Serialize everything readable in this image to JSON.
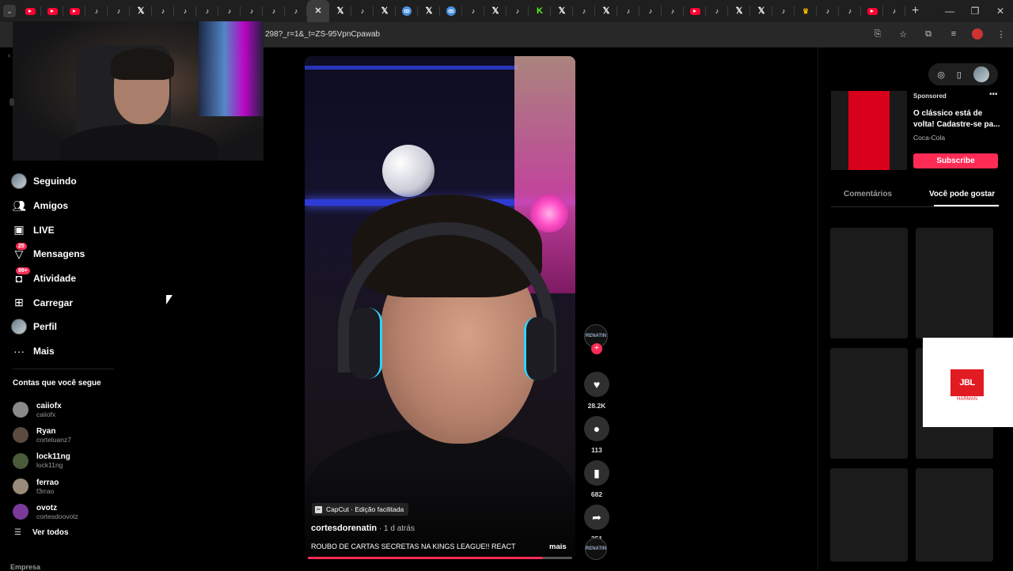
{
  "browser": {
    "tabs": [
      "yt",
      "yt",
      "yt",
      "tt",
      "tt",
      "x",
      "tt",
      "tt",
      "tt",
      "tt",
      "tt",
      "tt",
      "tt",
      "close",
      "x",
      "tt",
      "x",
      "meet",
      "x",
      "meet",
      "tt",
      "x",
      "tt",
      "kick",
      "x",
      "tt",
      "x",
      "tt",
      "tt",
      "tt",
      "yt",
      "tt",
      "x",
      "x",
      "tt",
      "crown",
      "tt",
      "tt",
      "yt",
      "tt"
    ],
    "tab_close_glyph": "✕",
    "new_tab_glyph": "+",
    "url": "298?_r=1&_t=ZS-95VpnCpawab"
  },
  "sidebar": {
    "items": [
      {
        "label": "Seguindo",
        "icon": "following-avatar-icon",
        "badge": ""
      },
      {
        "label": "Amigos",
        "icon": "friends-icon",
        "badge": ""
      },
      {
        "label": "LIVE",
        "icon": "live-tv-icon",
        "badge": ""
      },
      {
        "label": "Mensagens",
        "icon": "messages-icon",
        "badge": "25"
      },
      {
        "label": "Atividade",
        "icon": "activity-icon",
        "badge": "99+"
      },
      {
        "label": "Carregar",
        "icon": "upload-icon",
        "badge": ""
      },
      {
        "label": "Perfil",
        "icon": "profile-avatar-icon",
        "badge": ""
      },
      {
        "label": "Mais",
        "icon": "more-dots-icon",
        "badge": ""
      }
    ],
    "following_header": "Contas que você segue",
    "accounts": [
      {
        "name": "caiiofx",
        "handle": "caiiofx",
        "color": "#8a8a8a"
      },
      {
        "name": "Ryan",
        "handle": "corteluanz7",
        "color": "#5a4a40"
      },
      {
        "name": "lock11ng",
        "handle": "lock11ng",
        "color": "#4a5a3a"
      },
      {
        "name": "ferrao",
        "handle": "f3rrao",
        "color": "#9a8a7a"
      },
      {
        "name": "ovotz",
        "handle": "cortesdoovotz",
        "color": "#7a3a9a"
      }
    ],
    "see_all": "Ver todos",
    "footer_label": "Empresa"
  },
  "video": {
    "capcut_label": "CapCut · Edição facilitada",
    "author": "cortesdorenatin",
    "time": " · 1 d atrás",
    "caption": "ROUBO DE CARTAS SECRETAS NA KINGS LEAGUE!! REACT",
    "more": "mais",
    "progress_fraction": 0.89
  },
  "actions": {
    "avatar_text": "RENATIN",
    "likes": "28.2K",
    "comments": "113",
    "saves": "682",
    "shares": "251"
  },
  "right_panel": {
    "ad": {
      "sponsored": "Sponsored",
      "title": "O clássico está de volta! Cadastre-se pa...",
      "brand": "Coca-Cola",
      "cta": "Subscribe"
    },
    "tabs": {
      "comments": "Comentários",
      "you_may_like": "Você pode gostar"
    },
    "popup": {
      "logo": "JBL",
      "sub": "HARMAN"
    }
  },
  "colors": {
    "accent": "#fe2c55",
    "ad_red": "#d9001b"
  }
}
